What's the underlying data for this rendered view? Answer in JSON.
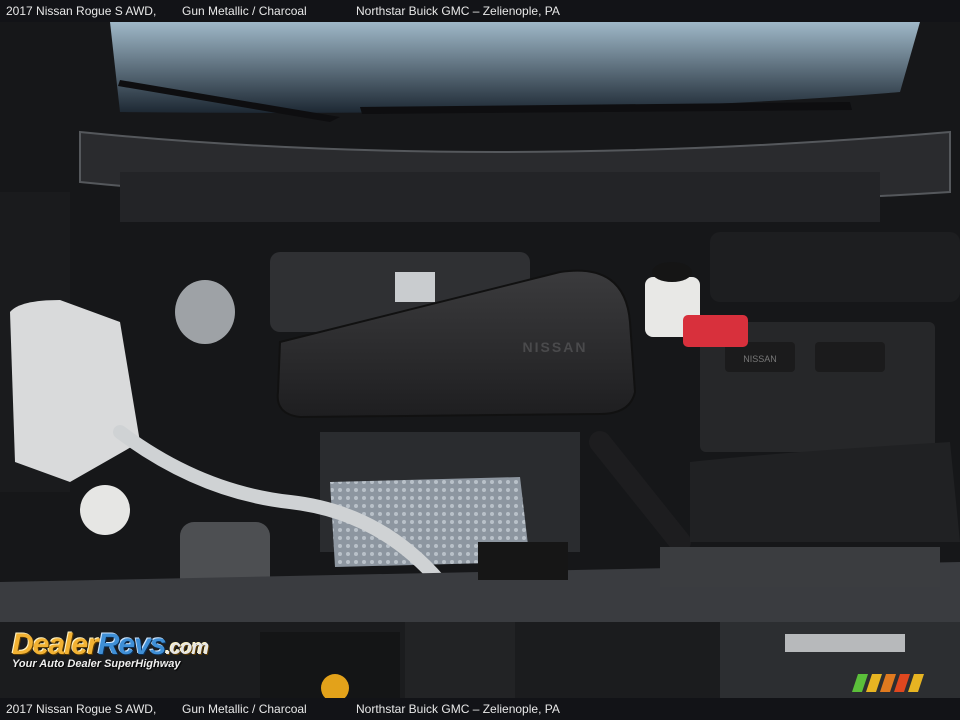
{
  "caption": {
    "vehicle": "2017 Nissan Rogue S AWD,",
    "color": "Gun Metallic / Charcoal",
    "dealer": "Northstar Buick GMC – Zelienople, PA"
  },
  "photo": {
    "engine_badge": "NISSAN",
    "battery_label": "NISSAN",
    "colors": {
      "engine_cover": "#2b2b2c",
      "battery_terminal": "#d8303c",
      "heat_shield": "#9aa3ad"
    }
  },
  "watermark": {
    "logo_part1": "Dealer",
    "logo_part2": "Revs",
    "logo_part3": ".com",
    "tagline": "Your Auto Dealer SuperHighway"
  }
}
